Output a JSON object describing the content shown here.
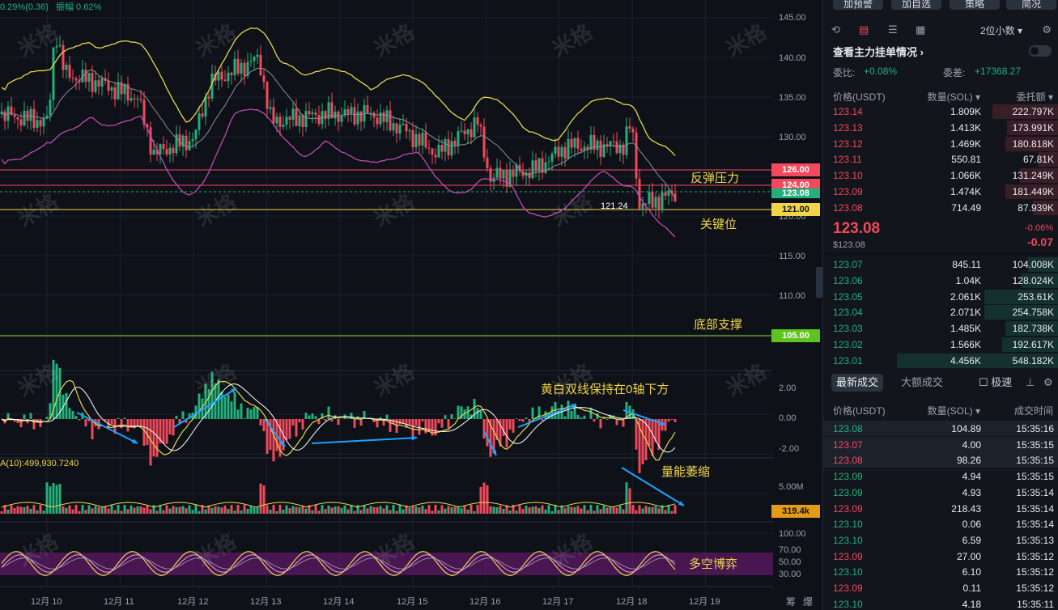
{
  "header": {
    "change": "0.29%(0.36)",
    "amplitude": "振幅 0.62%"
  },
  "colors": {
    "up": "#22b07d",
    "down": "#f2495c",
    "boll": "#e6d84a",
    "ma_gray": "#8a8f98",
    "boll_lower": "#c04bb0",
    "macd_line": "#e6d84a",
    "signal_line": "#ffffff",
    "arrow": "#1aa3ff"
  },
  "price_axis": {
    "ticks": [
      "145.00",
      "140.00",
      "135.00",
      "130.00",
      "120.00",
      "115.00",
      "110.00",
      "100.00"
    ]
  },
  "price_lines": [
    {
      "label": "126.00",
      "color": "#f2495c"
    },
    {
      "label": "124.00",
      "color": "#f2495c"
    },
    {
      "label": "123.08",
      "color": "#22b07d"
    },
    {
      "label": "121.00",
      "color": "#f0d54a"
    },
    {
      "label": "105.00",
      "color": "#7dd321"
    }
  ],
  "low_marker": "121.24",
  "annotations": {
    "resistance": "反弹压力",
    "key_level": "关键位",
    "support": "底部支撑",
    "macd_note": "黄白双线保持在0轴下方",
    "volume_note": "量能萎缩",
    "rsi_note": "多空博弈"
  },
  "macd_axis": [
    "2.00",
    "0.00",
    "-2.00"
  ],
  "volume": {
    "label": "A(10):499,930.7240",
    "axis": "5.00M",
    "current": "319.4k"
  },
  "rsi_axis": [
    "100.00",
    "70.00",
    "50.00",
    "30.00",
    "0.00"
  ],
  "x_axis": [
    "12月 10",
    "12月 11",
    "12月 12",
    "12月 13",
    "12月 14",
    "12月 15",
    "12月 16",
    "12月 17",
    "12月 18",
    "12月 19"
  ],
  "corner": {
    "left": "筹",
    "right": "爆"
  },
  "watermark": "米格",
  "right_panel": {
    "top_buttons": [
      "加预警",
      "加自选",
      "策略",
      "简况"
    ],
    "toolbar_icons": [
      "undo-icon",
      "layout-icon",
      "list-icon",
      "grid-icon"
    ],
    "decimals": "2位小数",
    "depth_title": "查看主力挂单情况",
    "ratio_label": "委比:",
    "ratio_value": "+0.08%",
    "diff_label": "委差:",
    "diff_value": "+17368.27",
    "ob_headers": [
      "价格(USDT)",
      "数量(SOL)",
      "委托额"
    ],
    "asks": [
      {
        "price": "123.14",
        "qty": "1.809K",
        "amt": "222.797K",
        "fill": 0.41
      },
      {
        "price": "123.13",
        "qty": "1.413K",
        "amt": "173.991K",
        "fill": 0.32
      },
      {
        "price": "123.12",
        "qty": "1.469K",
        "amt": "180.818K",
        "fill": 0.33
      },
      {
        "price": "123.11",
        "qty": "550.81",
        "amt": "67.81K",
        "fill": 0.13
      },
      {
        "price": "123.10",
        "qty": "1.066K",
        "amt": "131.249K",
        "fill": 0.24
      },
      {
        "price": "123.09",
        "qty": "1.474K",
        "amt": "181.449K",
        "fill": 0.33
      },
      {
        "price": "123.08",
        "qty": "714.49",
        "amt": "87.939K",
        "fill": 0.16
      }
    ],
    "last_price": "123.08",
    "last_usd": "$123.08",
    "pct_change": "-0.06%",
    "abs_change": "-0.07",
    "bids": [
      {
        "price": "123.07",
        "qty": "845.11",
        "amt": "104.008K",
        "fill": 0.19
      },
      {
        "price": "123.06",
        "qty": "1.04K",
        "amt": "128.024K",
        "fill": 0.23
      },
      {
        "price": "123.05",
        "qty": "2.061K",
        "amt": "253.61K",
        "fill": 0.46
      },
      {
        "price": "123.04",
        "qty": "2.071K",
        "amt": "254.758K",
        "fill": 0.46
      },
      {
        "price": "123.03",
        "qty": "1.485K",
        "amt": "182.738K",
        "fill": 0.33
      },
      {
        "price": "123.02",
        "qty": "1.566K",
        "amt": "192.617K",
        "fill": 0.35
      },
      {
        "price": "123.01",
        "qty": "4.456K",
        "amt": "548.182K",
        "fill": 1.0
      }
    ],
    "trade_tabs": [
      "最新成交",
      "大额成交"
    ],
    "speed_label": "极速",
    "trade_headers": [
      "价格(USDT)",
      "数量(SOL)",
      "成交时间"
    ],
    "trades": [
      {
        "price": "123.08",
        "qty": "104.89",
        "time": "15:35:16",
        "side": "up"
      },
      {
        "price": "123.07",
        "qty": "4.00",
        "time": "15:35:15",
        "side": "down"
      },
      {
        "price": "123.08",
        "qty": "98.26",
        "time": "15:35:15",
        "side": "down"
      },
      {
        "price": "123.09",
        "qty": "4.94",
        "time": "15:35:15",
        "side": "up"
      },
      {
        "price": "123.09",
        "qty": "4.93",
        "time": "15:35:14",
        "side": "up"
      },
      {
        "price": "123.09",
        "qty": "218.43",
        "time": "15:35:14",
        "side": "down"
      },
      {
        "price": "123.10",
        "qty": "0.06",
        "time": "15:35:14",
        "side": "up"
      },
      {
        "price": "123.10",
        "qty": "6.59",
        "time": "15:35:13",
        "side": "up"
      },
      {
        "price": "123.09",
        "qty": "27.00",
        "time": "15:35:12",
        "side": "down"
      },
      {
        "price": "123.10",
        "qty": "6.10",
        "time": "15:35:12",
        "side": "up"
      },
      {
        "price": "123.09",
        "qty": "0.11",
        "time": "15:35:12",
        "side": "down"
      },
      {
        "price": "123.10",
        "qty": "4.18",
        "time": "15:35:11",
        "side": "up"
      }
    ]
  }
}
